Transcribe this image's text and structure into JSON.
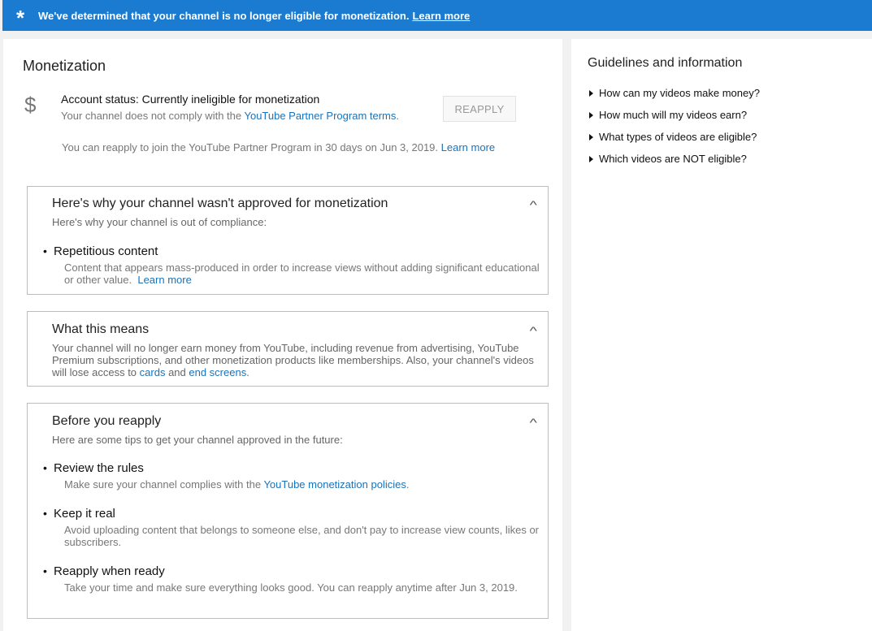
{
  "banner": {
    "icon": "asterisk-icon",
    "text": "We've determined that your channel is no longer eligible for monetization.",
    "link": "Learn more",
    "color": "#1a7bd1"
  },
  "monetization": {
    "title": "Monetization",
    "icon": "dollar-icon",
    "status": "Account status: Currently ineligible for monetization",
    "status_sub_prefix": "Your channel does not comply with the ",
    "status_sub_link": "YouTube Partner Program terms",
    "status_sub_suffix": ".",
    "reapply_button": "REAPPLY",
    "reapply_note": "You can reapply to join the YouTube Partner Program in 30 days on Jun 3, 2019.",
    "reapply_note_link": "Learn more"
  },
  "why_card": {
    "title": "Here's why your channel wasn't approved for monetization",
    "subtitle": "Here's why your channel is out of compliance:",
    "items": [
      {
        "title": "Repetitious content",
        "desc": "Content that appears mass-produced in order to increase views without adding significant educational or other value.",
        "link": "Learn more"
      }
    ]
  },
  "means_card": {
    "title": "What this means",
    "text_prefix": "Your channel will no longer earn money from YouTube, including revenue from advertising, YouTube Premium subscriptions, and other monetization products like memberships. Also, your channel's videos will lose access to ",
    "link_cards": "cards",
    "text_and": " and ",
    "link_end_screens": "end screens",
    "text_suffix": "."
  },
  "before_card": {
    "title": "Before you reapply",
    "subtitle": "Here are some tips to get your channel approved in the future:",
    "items": [
      {
        "title": "Review the rules",
        "desc_prefix": "Make sure your channel complies with the ",
        "desc_link": "YouTube monetization policies",
        "desc_suffix": "."
      },
      {
        "title": "Keep it real",
        "desc": "Avoid uploading content that belongs to someone else, and don't pay to increase view counts, likes or subscribers."
      },
      {
        "title": "Reapply when ready",
        "desc": "Take your time and make sure everything looks good. You can reapply anytime after Jun 3, 2019."
      }
    ]
  },
  "guidelines": {
    "title": "Guidelines and information",
    "items": [
      "How can my videos make money?",
      "How much will my videos earn?",
      "What types of videos are eligible?",
      "Which videos are NOT eligible?"
    ]
  },
  "colors": {
    "link": "#1a73b8",
    "banner": "#1a7bd1"
  }
}
